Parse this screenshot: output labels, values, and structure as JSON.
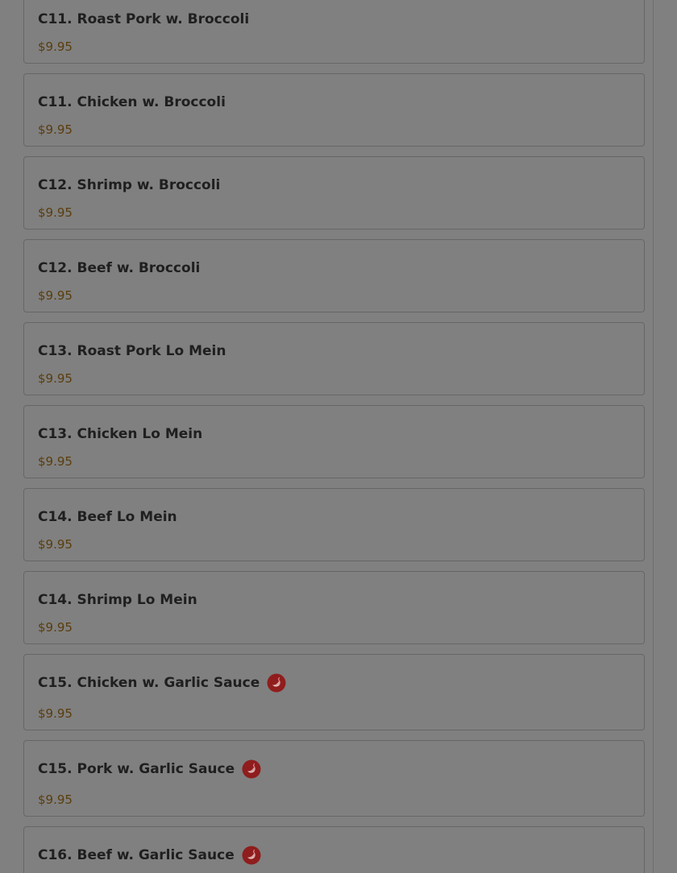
{
  "menu": {
    "items": [
      {
        "name": "C11. Roast Pork w. Broccoli",
        "price": "$9.95",
        "spicy": false
      },
      {
        "name": "C11. Chicken w. Broccoli",
        "price": "$9.95",
        "spicy": false
      },
      {
        "name": "C12. Shrimp w. Broccoli",
        "price": "$9.95",
        "spicy": false
      },
      {
        "name": "C12. Beef w. Broccoli",
        "price": "$9.95",
        "spicy": false
      },
      {
        "name": "C13. Roast Pork Lo Mein",
        "price": "$9.95",
        "spicy": false
      },
      {
        "name": "C13. Chicken Lo Mein",
        "price": "$9.95",
        "spicy": false
      },
      {
        "name": "C14. Beef Lo Mein",
        "price": "$9.95",
        "spicy": false
      },
      {
        "name": "C14. Shrimp Lo Mein",
        "price": "$9.95",
        "spicy": false
      },
      {
        "name": "C15. Chicken w. Garlic Sauce",
        "price": "$9.95",
        "spicy": true,
        "icon": "chili-pepper-icon"
      },
      {
        "name": "C15. Pork w. Garlic Sauce",
        "price": "$9.95",
        "spicy": true,
        "icon": "chili-pepper-icon"
      },
      {
        "name": "C16. Beef w. Garlic Sauce",
        "price": "",
        "spicy": true,
        "icon": "chili-pepper-icon"
      }
    ]
  },
  "colors": {
    "overlay_background": "#808080",
    "card_border": "#666666",
    "item_name": "#1f1f1f",
    "price": "#5a3d0c",
    "spicy_icon": "#8f1d1d"
  }
}
